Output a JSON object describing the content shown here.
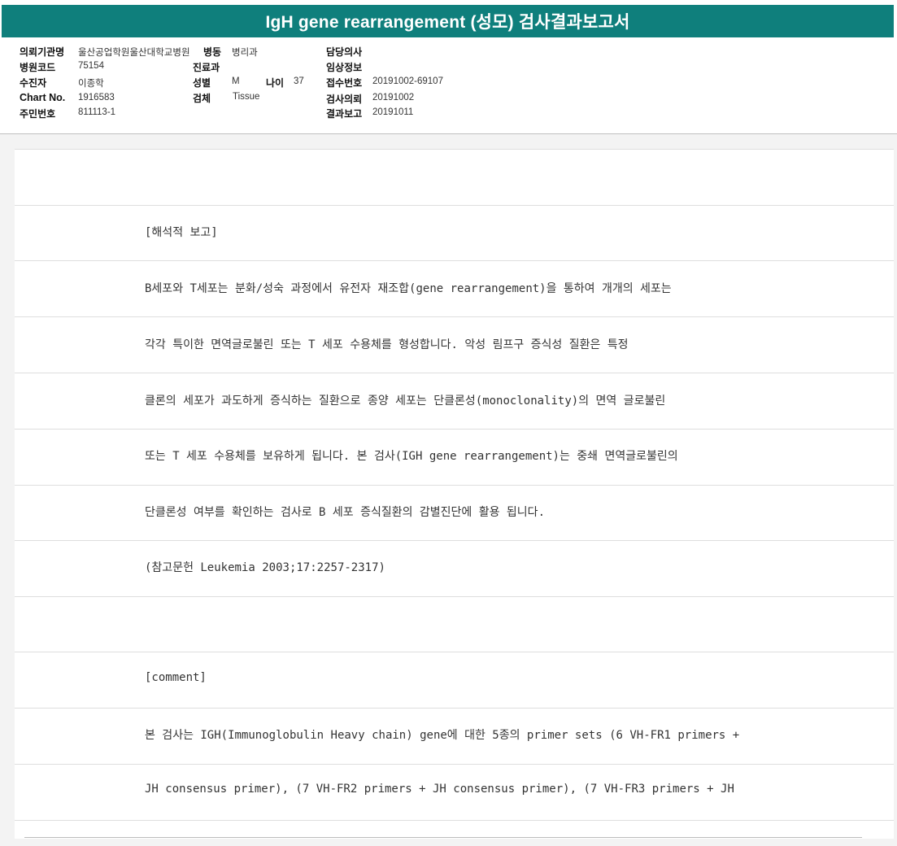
{
  "title": "IgH gene rearrangement (성모) 검사결과보고서",
  "info": {
    "referring_institution_label": "의뢰기관명",
    "referring_institution_value": "울산공업학원울산대학교병원",
    "ward_label": "병동",
    "ward_value": "병리과",
    "physician_label": "담당의사",
    "physician_value": "",
    "hospital_code_label": "병원코드",
    "hospital_code_value": "75154",
    "department_label": "진료과",
    "department_value": "",
    "clinical_info_label": "임상정보",
    "clinical_info_value": "",
    "patient_label": "수진자",
    "patient_value": "이종학",
    "sex_label": "성별",
    "sex_value": "M",
    "age_label": "나이",
    "age_value": "37",
    "receipt_no_label": "접수번호",
    "receipt_no_value": "20191002-69107",
    "chart_label": "Chart No.",
    "chart_value": "1916583",
    "specimen_label": "검체",
    "specimen_value": "Tissue",
    "request_label": "검사의뢰",
    "request_value": "20191002",
    "id_label": "주민번호",
    "id_value": "811113-1",
    "result_label": "결과보고",
    "result_value": "20191011"
  },
  "report_lines": [
    "",
    "[해석적 보고]",
    "B세포와 T세포는 분화/성숙 과정에서 유전자 재조합(gene rearrangement)을 통하여 개개의 세포는",
    "각각 특이한 면역글로불린 또는 T 세포 수용체를 형성합니다. 악성 림프구 증식성 질환은 특정",
    "클론의 세포가 과도하게 증식하는 질환으로 종양 세포는 단클론성(monoclonality)의 면역 글로불린",
    "또는 T 세포 수용체를 보유하게 됩니다. 본 검사(IGH gene rearrangement)는 중쇄 면역글로불린의",
    "단클론성 여부를 확인하는 검사로 B 세포 증식질환의 감별진단에 활용 됩니다.",
    "(참고문헌 Leukemia 2003;17:2257-2317)",
    "",
    "[comment]",
    "본 검사는 IGH(Immunoglobulin Heavy chain) gene에 대한 5종의 primer sets (6 VH-FR1 primers +",
    "JH consensus primer), (7 VH-FR2 primers + JH consensus primer), (7 VH-FR3 primers + JH"
  ]
}
